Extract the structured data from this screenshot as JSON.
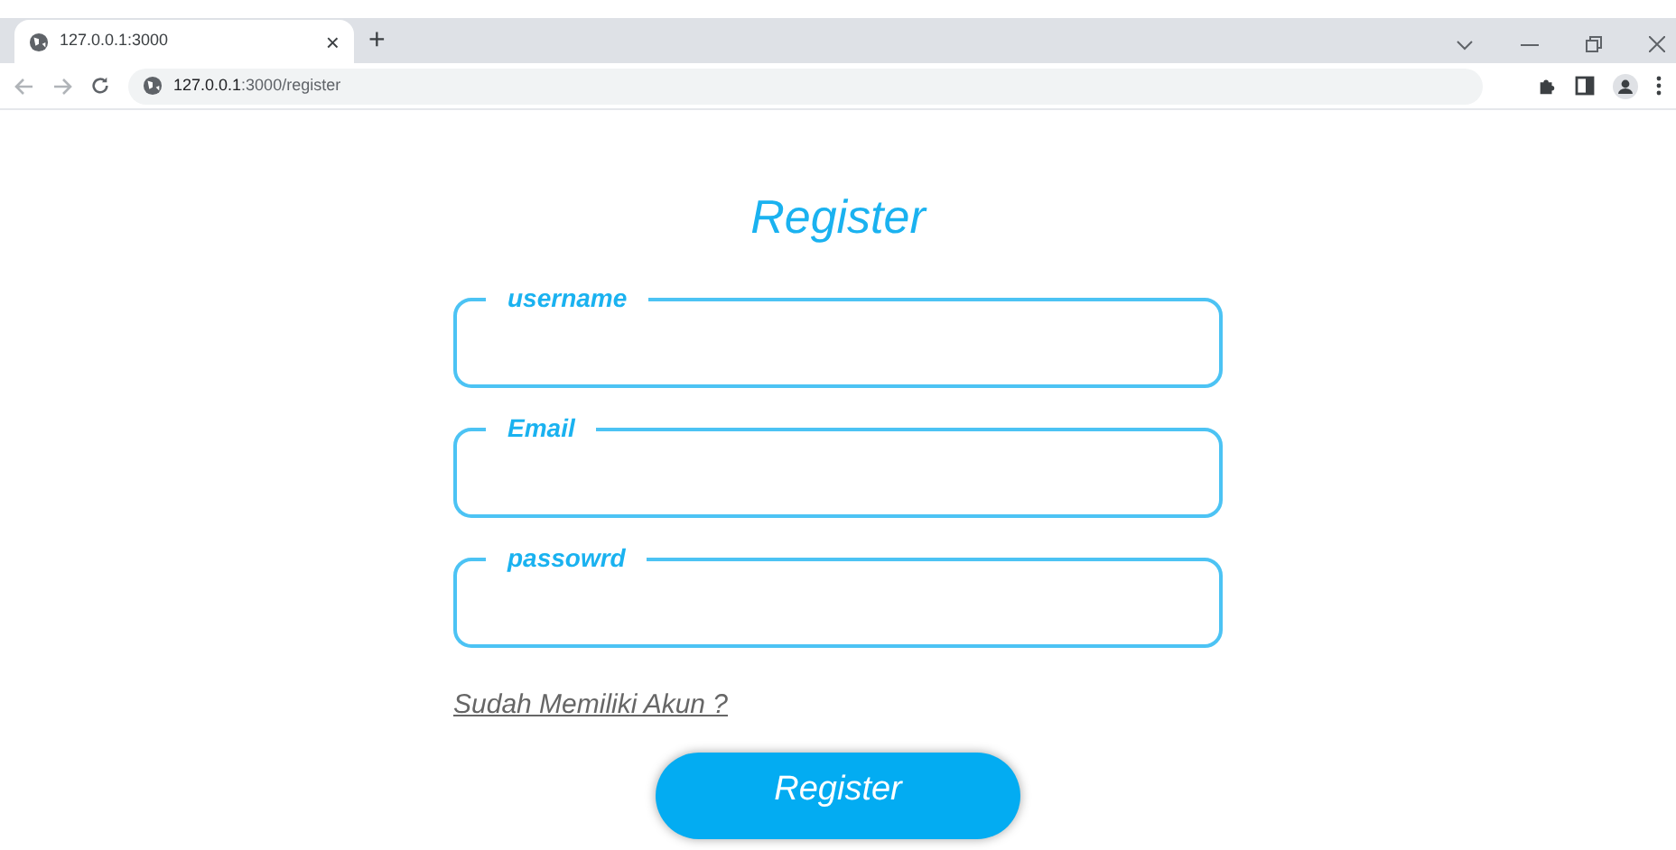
{
  "browser": {
    "tab": {
      "title": "127.0.0.1:3000",
      "close": "×",
      "new_tab": "+"
    },
    "address": {
      "host": "127.0.0.1",
      "path": ":3000/register"
    }
  },
  "page": {
    "title": "Register",
    "fields": [
      {
        "label": "username"
      },
      {
        "label": "Email"
      },
      {
        "label": "passowrd"
      }
    ],
    "login_link": "Sudah Memiliki Akun ?",
    "submit": "Register"
  }
}
